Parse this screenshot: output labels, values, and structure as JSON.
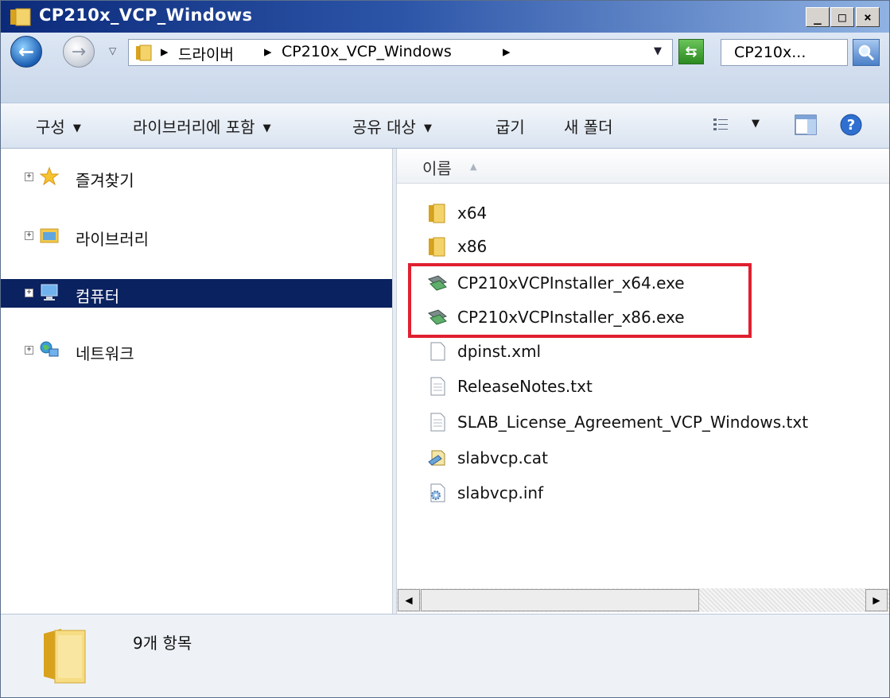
{
  "window": {
    "title": "CP210x_VCP_Windows",
    "controls": {
      "minimize": "_",
      "maximize": "□",
      "close": "×"
    }
  },
  "address_bar": {
    "breadcrumbs": [
      "드라이버",
      "CP210x_VCP_Windows"
    ],
    "search_value": "CP210x..."
  },
  "toolbar": {
    "organize": "구성",
    "include_in_library": "라이브러리에 포함",
    "share_with": "공유 대상",
    "burn": "굽기",
    "new_folder": "새 폴더"
  },
  "nav": {
    "items": [
      {
        "label": "즐겨찾기",
        "icon": "star-icon"
      },
      {
        "label": "라이브러리",
        "icon": "library-icon"
      },
      {
        "label": "컴퓨터",
        "icon": "computer-icon",
        "selected": true
      },
      {
        "label": "네트워크",
        "icon": "network-icon"
      }
    ]
  },
  "content": {
    "column_header": "이름",
    "files": [
      {
        "name": "x64",
        "icon": "folder-icon"
      },
      {
        "name": "x86",
        "icon": "folder-icon"
      },
      {
        "name": "CP210xVCPInstaller_x64.exe",
        "icon": "installer-icon"
      },
      {
        "name": "CP210xVCPInstaller_x86.exe",
        "icon": "installer-icon"
      },
      {
        "name": "dpinst.xml",
        "icon": "file-icon"
      },
      {
        "name": "ReleaseNotes.txt",
        "icon": "text-file-icon"
      },
      {
        "name": "SLAB_License_Agreement_VCP_Windows.txt",
        "icon": "text-file-icon"
      },
      {
        "name": "slabvcp.cat",
        "icon": "catalog-file-icon"
      },
      {
        "name": "slabvcp.inf",
        "icon": "settings-file-icon"
      }
    ]
  },
  "details": {
    "item_count": "9개 항목"
  },
  "colors": {
    "highlight": "#e02030",
    "selected_nav": "#0b2260"
  }
}
